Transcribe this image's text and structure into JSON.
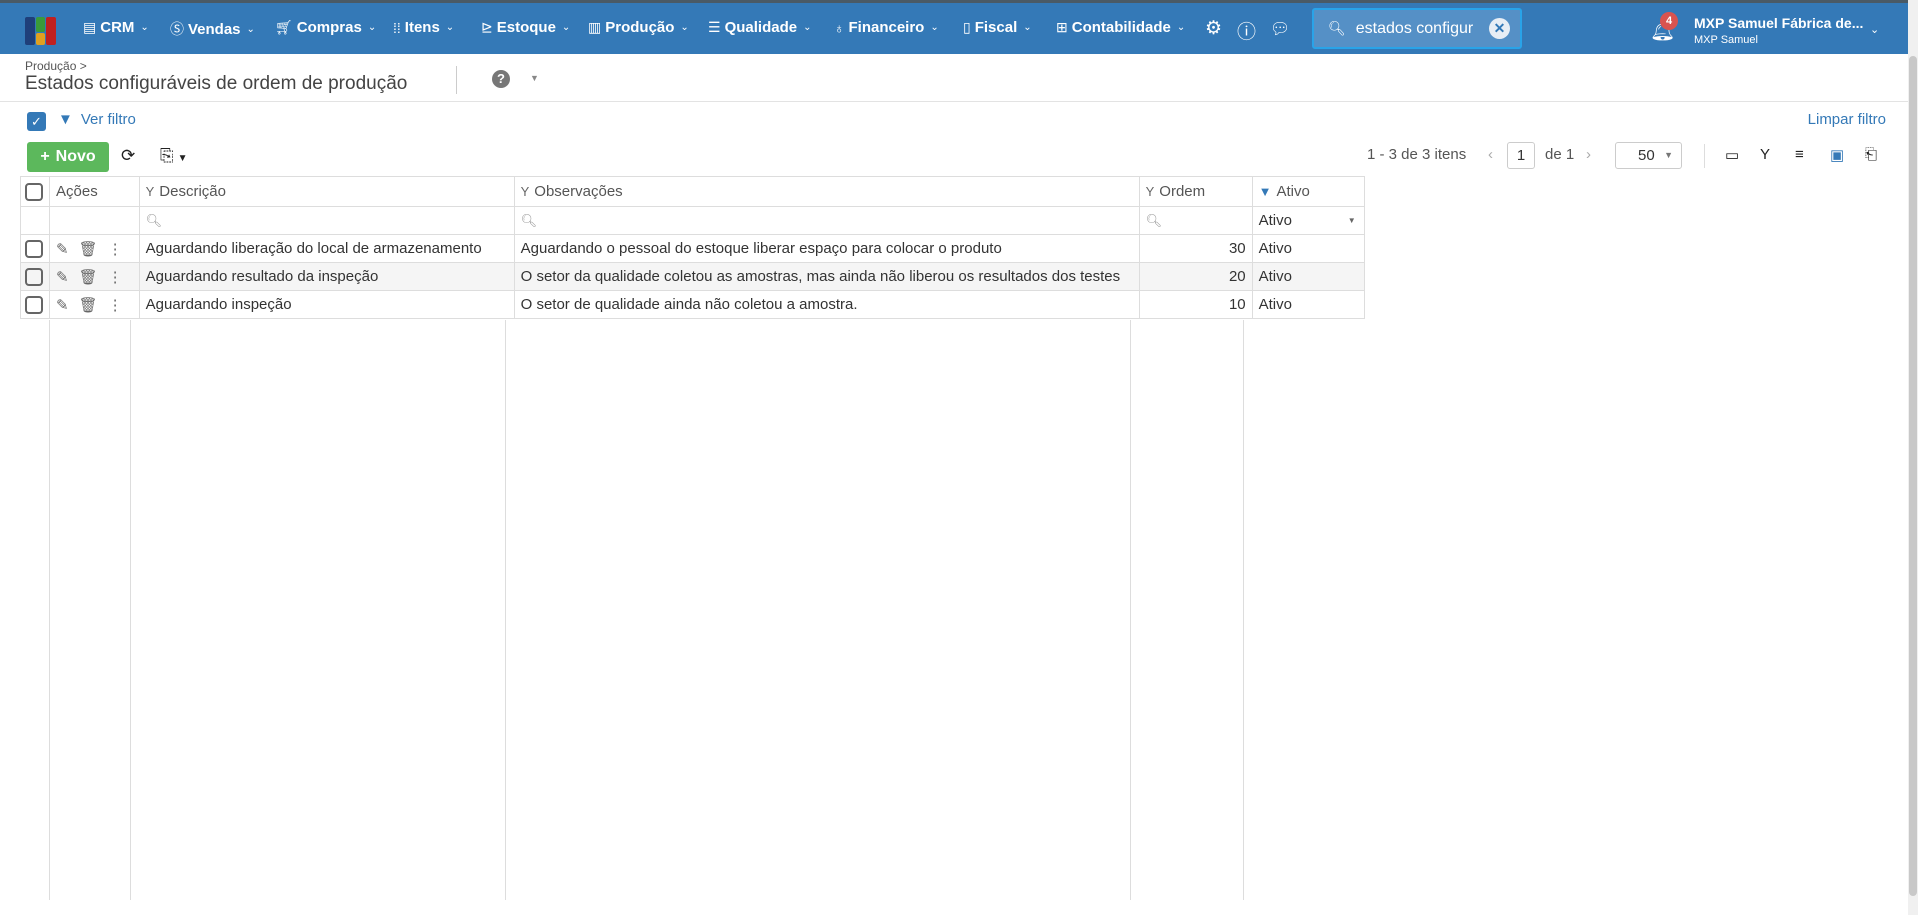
{
  "nav": {
    "items": [
      {
        "label": "CRM",
        "icon": "crm-icon"
      },
      {
        "label": "Vendas",
        "icon": "dollar-icon"
      },
      {
        "label": "Compras",
        "icon": "cart-icon"
      },
      {
        "label": "Itens",
        "icon": "items-icon"
      },
      {
        "label": "Estoque",
        "icon": "dolly-icon"
      },
      {
        "label": "Produção",
        "icon": "factory-icon"
      },
      {
        "label": "Qualidade",
        "icon": "checklist-icon"
      },
      {
        "label": "Financeiro",
        "icon": "moneybag-icon"
      },
      {
        "label": "Fiscal",
        "icon": "document-icon"
      },
      {
        "label": "Contabilidade",
        "icon": "calculator-icon"
      }
    ],
    "search_value": "estados configur",
    "notification_count": "4",
    "user_company": "MXP Samuel Fábrica de...",
    "user_name": "MXP Samuel"
  },
  "page": {
    "breadcrumb": "Produção >",
    "title": "Estados configuráveis de ordem de produção"
  },
  "filter": {
    "ver_filtro": "Ver filtro",
    "limpar_filtro": "Limpar filtro"
  },
  "toolbar": {
    "novo": "Novo"
  },
  "pagination": {
    "summary": "1 - 3 de 3 itens",
    "page": "1",
    "de": "de",
    "total_pages": "1",
    "page_size": "50"
  },
  "table": {
    "columns": [
      "Ações",
      "Descrição",
      "Observações",
      "Ordem",
      "Ativo"
    ],
    "ativo_filter": "Ativo",
    "rows": [
      {
        "descricao": "Aguardando liberação do local de armazenamento",
        "observacoes": "Aguardando o pessoal do estoque liberar espaço para colocar o produto",
        "ordem": "30",
        "ativo": "Ativo"
      },
      {
        "descricao": "Aguardando resultado da inspeção",
        "observacoes": "O setor da qualidade coletou as amostras, mas ainda não liberou os resultados dos testes",
        "ordem": "20",
        "ativo": "Ativo"
      },
      {
        "descricao": "Aguardando inspeção",
        "observacoes": "O setor de qualidade ainda não coletou a amostra.",
        "ordem": "10",
        "ativo": "Ativo"
      }
    ]
  },
  "colors": {
    "nav": "#3479b7",
    "novo": "#5cb85c",
    "badge": "#d9534f",
    "link": "#3479b7"
  }
}
